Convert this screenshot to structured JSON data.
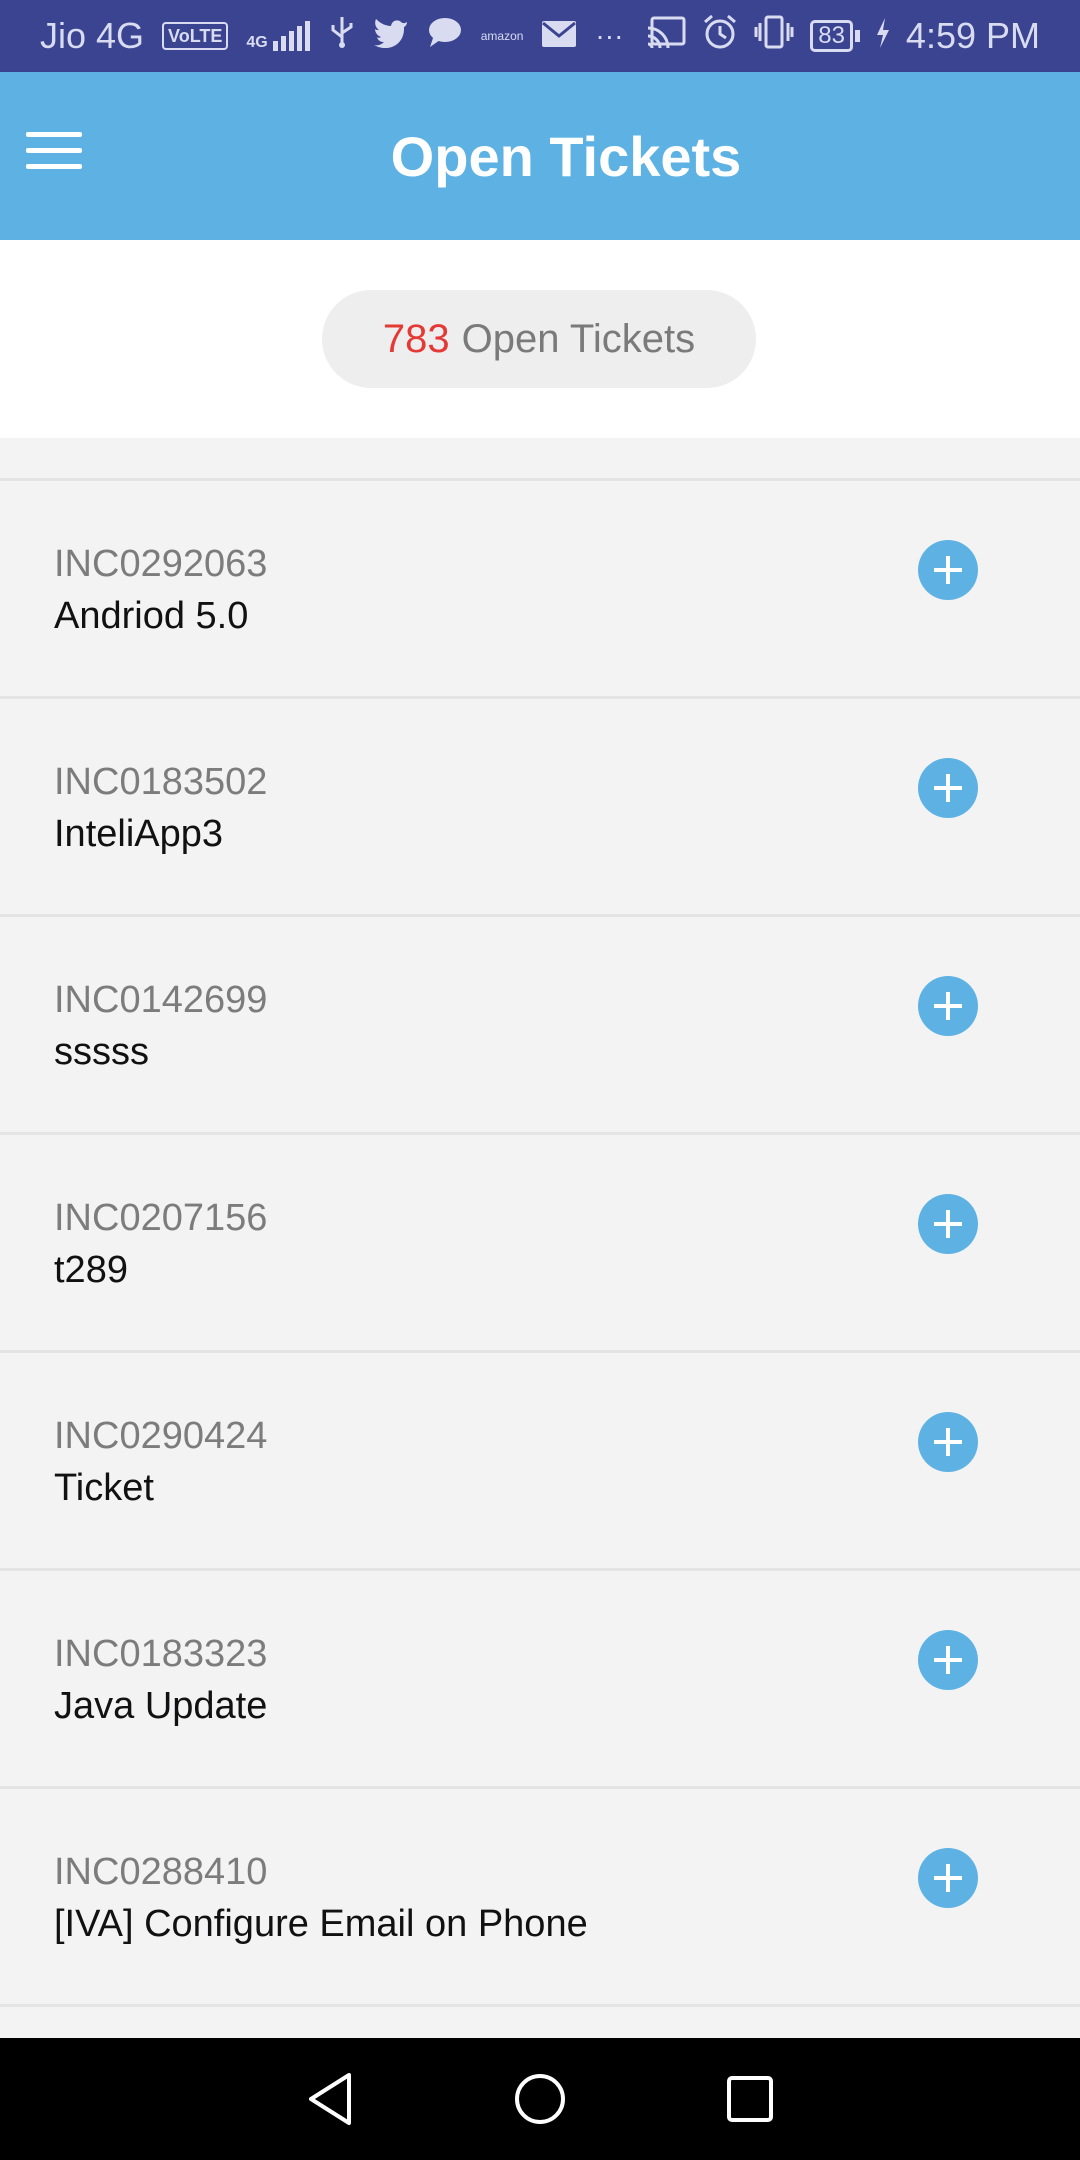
{
  "status_bar": {
    "carrier": "Jio 4G",
    "volte": "VoLTE",
    "network": "4G",
    "amazon": "amazon",
    "more": "···",
    "battery": "83",
    "time": "4:59 PM"
  },
  "app_bar": {
    "title": "Open Tickets"
  },
  "summary": {
    "count": "783",
    "label": "Open Tickets"
  },
  "tickets": [
    {
      "id": "INC0292063",
      "title": "Andriod 5.0"
    },
    {
      "id": "INC0183502",
      "title": "InteliApp3"
    },
    {
      "id": "INC0142699",
      "title": "sssss"
    },
    {
      "id": "INC0207156",
      "title": "t289"
    },
    {
      "id": "INC0290424",
      "title": "Ticket"
    },
    {
      "id": "INC0183323",
      "title": "Java Update"
    },
    {
      "id": "INC0288410",
      "title": "[IVA] Configure Email on Phone"
    }
  ],
  "colors": {
    "status_bar": "#3a4491",
    "accent": "#5db2e3",
    "count_highlight": "#e53935"
  }
}
